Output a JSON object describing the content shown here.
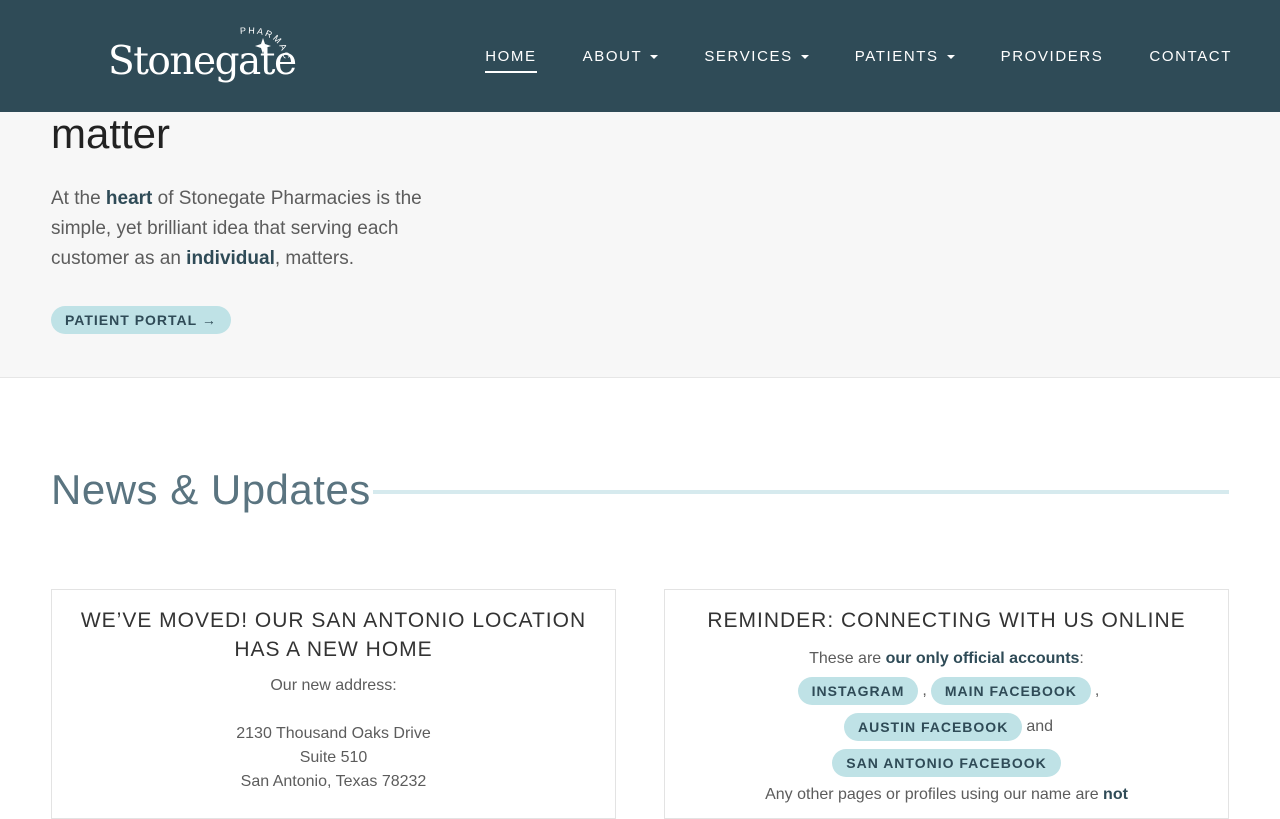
{
  "header": {
    "logo": {
      "word": "Stonegate",
      "tagline": "PHARMACY"
    },
    "nav": [
      {
        "label": "HOME",
        "active": true,
        "dropdown": false
      },
      {
        "label": "ABOUT",
        "active": false,
        "dropdown": true
      },
      {
        "label": "SERVICES",
        "active": false,
        "dropdown": true
      },
      {
        "label": "PATIENTS",
        "active": false,
        "dropdown": true
      },
      {
        "label": "PROVIDERS",
        "active": false,
        "dropdown": false
      },
      {
        "label": "CONTACT",
        "active": false,
        "dropdown": false
      }
    ]
  },
  "hero": {
    "title": "matter",
    "text_1": "At the ",
    "text_heart": "heart",
    "text_2": " of Stonegate Pharmacies is the simple, yet brilliant idea that serving each customer as an ",
    "text_individual": "individual",
    "text_3": ", matters.",
    "portal_button": "PATIENT PORTAL →"
  },
  "news": {
    "title": "News & Updates",
    "cards": [
      {
        "title": "WE’VE MOVED! OUR SAN ANTONIO LOCATION HAS A NEW HOME",
        "intro": "Our new address:",
        "address_line1": "2130 Thousand Oaks Drive",
        "address_line2": "Suite 510",
        "address_line3": "San Antonio, Texas 78232"
      },
      {
        "title": "REMINDER: CONNECTING WITH US ONLINE",
        "line1_a": "These are ",
        "line1_b": "our only official accounts",
        "line1_c": ":",
        "instagram": "INSTAGRAM",
        "comma": ",",
        "main_facebook": "MAIN FACEBOOK",
        "austin_facebook": "AUSTIN FACEBOOK",
        "and": "and",
        "sa_facebook": "SAN ANTONIO FACEBOOK",
        "last_a": "Any other pages or profiles using our name are ",
        "last_b": "not"
      }
    ]
  },
  "colors": {
    "header_bg": "#2f4b57",
    "pill_bg": "#bfe2e6",
    "accent_text": "#2f4b57"
  }
}
